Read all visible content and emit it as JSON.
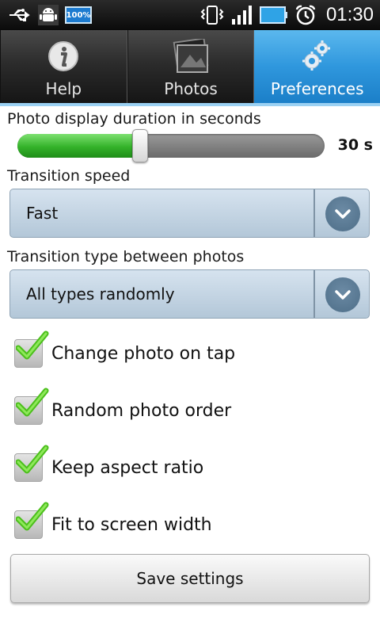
{
  "status_bar": {
    "battery_percent": "100%",
    "time": "01:30",
    "icons": [
      "usb-icon",
      "android-debug-icon",
      "battery-indicator-icon",
      "vibrate-icon",
      "signal-icon",
      "battery-icon",
      "alarm-icon"
    ]
  },
  "tabs": [
    {
      "label": "Help",
      "icon": "info-icon",
      "active": false
    },
    {
      "label": "Photos",
      "icon": "photos-icon",
      "active": false
    },
    {
      "label": "Preferences",
      "icon": "gears-icon",
      "active": true
    }
  ],
  "duration": {
    "label": "Photo display duration in seconds",
    "value_text": "30 s",
    "fraction": 0.4
  },
  "transition_speed": {
    "label": "Transition speed",
    "value": "Fast"
  },
  "transition_type": {
    "label": "Transition type between photos",
    "value": "All types randomly"
  },
  "options": [
    {
      "label": "Change photo on tap",
      "checked": true
    },
    {
      "label": "Random photo order",
      "checked": true
    },
    {
      "label": "Keep aspect ratio",
      "checked": true
    },
    {
      "label": "Fit to screen width",
      "checked": true
    }
  ],
  "save_label": "Save settings",
  "colors": {
    "accent_tab": "#2f97dd",
    "slider_fill": "#34b22a",
    "check_green": "#55cc22"
  }
}
